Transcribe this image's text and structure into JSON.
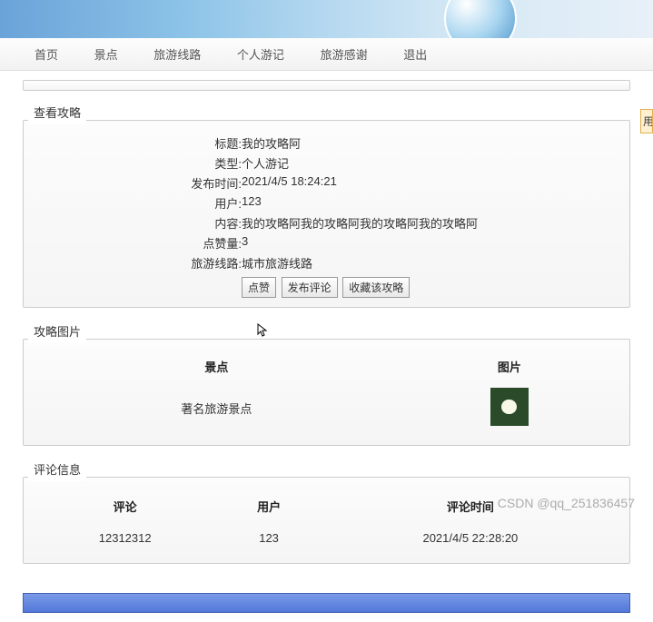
{
  "nav": {
    "items": [
      "首页",
      "景点",
      "旅游线路",
      "个人游记",
      "旅游感谢",
      "退出"
    ]
  },
  "sidepanel": {
    "title": "用"
  },
  "sections": {
    "view": {
      "title": "查看攻略",
      "rows": [
        {
          "label": "标题:",
          "value": "我的攻略阿"
        },
        {
          "label": "类型:",
          "value": "个人游记"
        },
        {
          "label": "发布时间:",
          "value": "2021/4/5 18:24:21"
        },
        {
          "label": "用户:",
          "value": "123"
        },
        {
          "label": "内容:",
          "value": "我的攻略阿我的攻略阿我的攻略阿我的攻略阿"
        },
        {
          "label": "点赞量:",
          "value": "3"
        },
        {
          "label": "旅游线路:",
          "value": "城市旅游线路"
        }
      ],
      "buttons": {
        "like": "点赞",
        "comment": "发布评论",
        "favorite": "收藏该攻略"
      }
    },
    "images": {
      "title": "攻略图片",
      "headers": {
        "spot": "景点",
        "pic": "图片"
      },
      "row": {
        "spot": "著名旅游景点"
      }
    },
    "comments": {
      "title": "评论信息",
      "headers": {
        "comment": "评论",
        "user": "用户",
        "time": "评论时间"
      },
      "row": {
        "comment": "12312312",
        "user": "123",
        "time": "2021/4/5 22:28:20"
      }
    }
  },
  "watermark": "CSDN @qq_251836457"
}
